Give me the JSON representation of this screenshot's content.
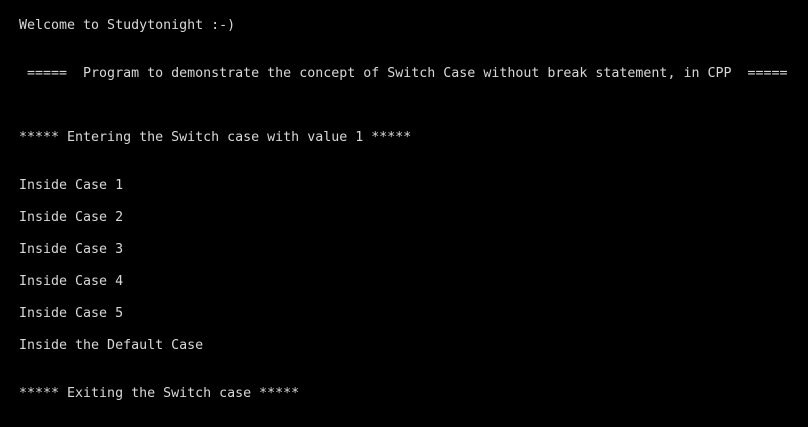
{
  "terminal": {
    "background_color": "#000000",
    "text_color": "#d8d8d8",
    "lines": [
      "Welcome to Studytonight :-)",
      " =====  Program to demonstrate the concept of Switch Case without break statement, in CPP  =====",
      "***** Entering the Switch case with value 1 *****",
      "Inside Case 1",
      "Inside Case 2",
      "Inside Case 3",
      "Inside Case 4",
      "Inside Case 5",
      "Inside the Default Case",
      "***** Exiting the Switch case *****"
    ]
  }
}
